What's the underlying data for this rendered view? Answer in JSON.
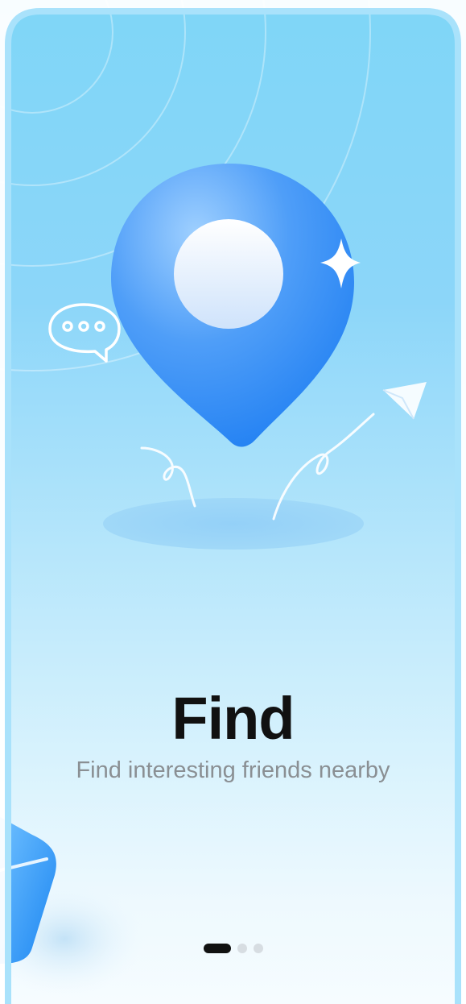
{
  "onboarding": {
    "title": "Find",
    "subtitle": "Find interesting friends nearby"
  },
  "pagination": {
    "total": 3,
    "active_index": 0
  },
  "colors": {
    "background_top": "#7fd6f7",
    "background_bottom": "#f6fcff",
    "pin_blue": "#2f86f6",
    "title_color": "#111111",
    "subtitle_color": "#8a8f93",
    "active_dot": "#111111",
    "inactive_dot": "#d7dde2"
  },
  "icons": {
    "pin": "location-pin-icon",
    "chat": "chat-bubble-icon",
    "sparkle": "sparkle-icon",
    "plane": "paper-plane-icon"
  }
}
